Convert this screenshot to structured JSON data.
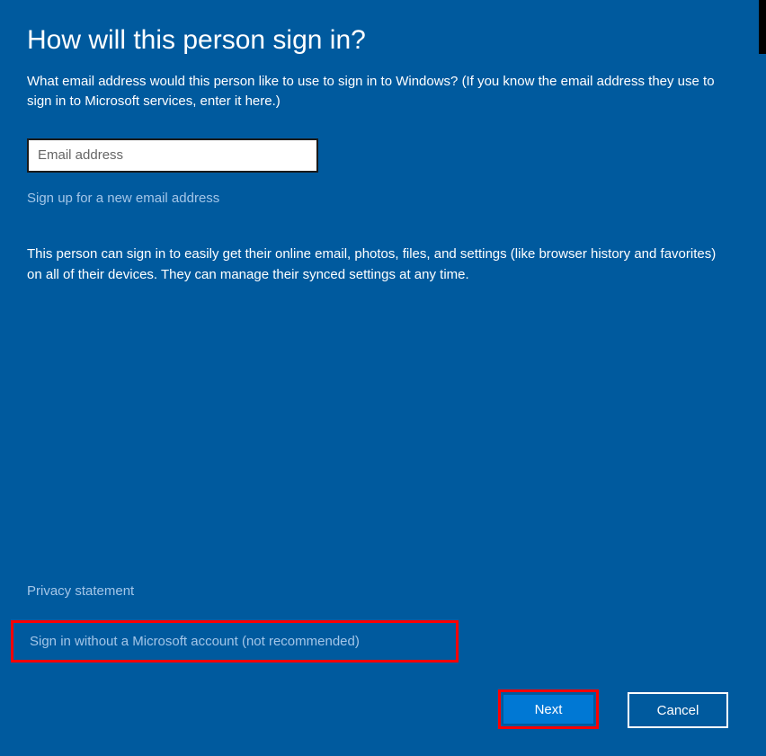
{
  "title": "How will this person sign in?",
  "description": "What email address would this person like to use to sign in to Windows? (If you know the email address they use to sign in to Microsoft services, enter it here.)",
  "email": {
    "placeholder": "Email address",
    "value": ""
  },
  "signup_link": "Sign up for a new email address",
  "info_text": "This person can sign in to easily get their online email, photos, files, and settings (like browser history and favorites) on all of their devices. They can manage their synced settings at any time.",
  "privacy_link": "Privacy statement",
  "signin_without_link": "Sign in without a Microsoft account (not recommended)",
  "buttons": {
    "next": "Next",
    "cancel": "Cancel"
  }
}
